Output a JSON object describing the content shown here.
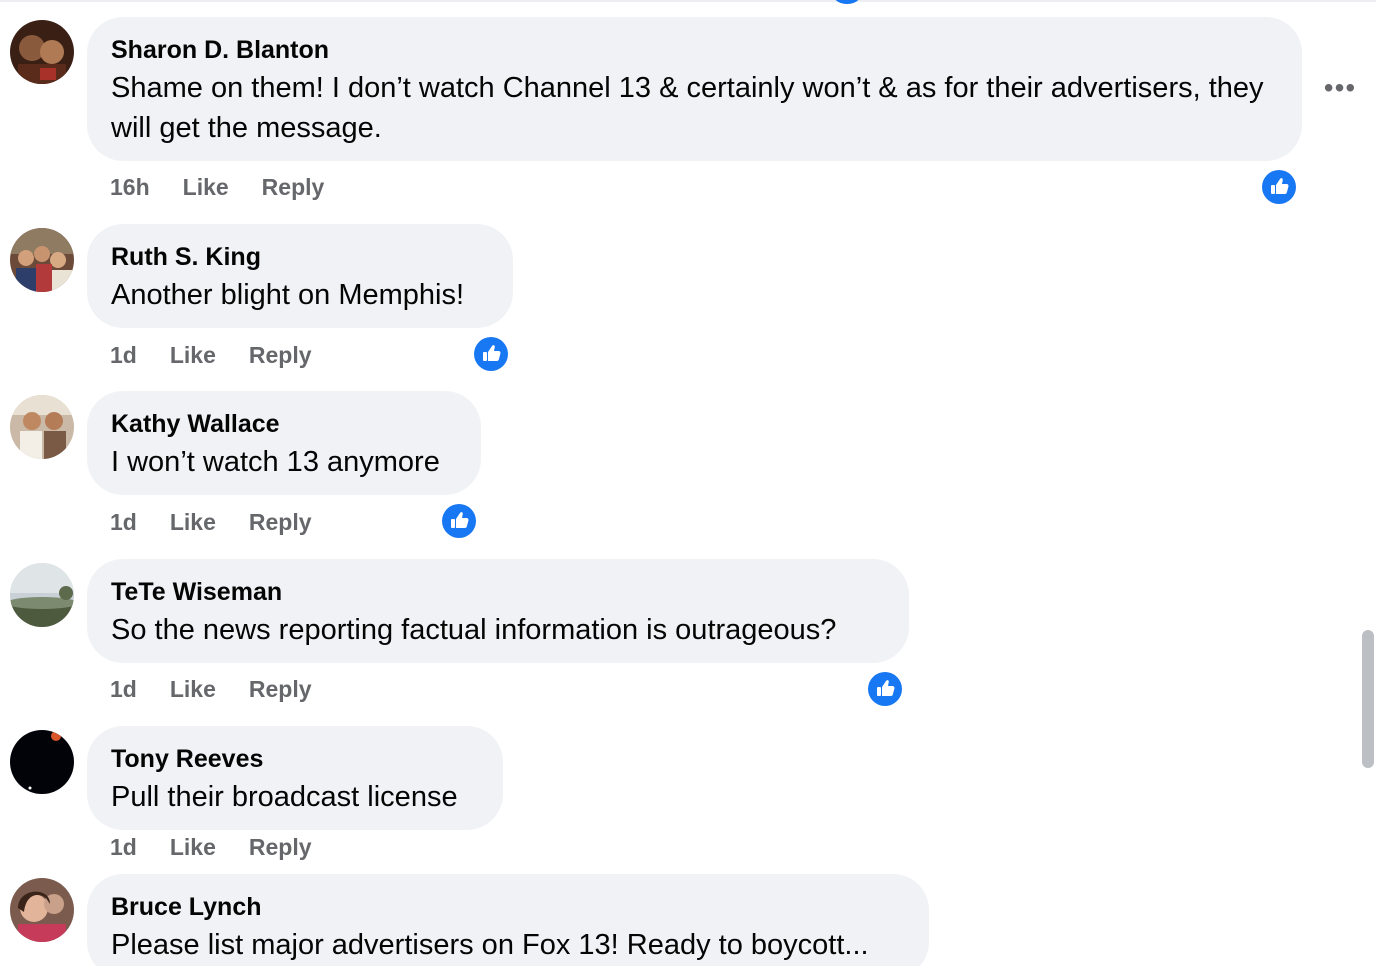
{
  "colors": {
    "bubble": "#f0f2f5",
    "meta_text": "#65676b",
    "like_blue": "#1877f2"
  },
  "more_icon": "•••",
  "comments": [
    {
      "author": "Sharon D. Blanton",
      "text": "Shame on them! I don’t watch Channel 13 & certainly won’t & as for their advertisers, they will get the message.",
      "time": "16h",
      "like": "Like",
      "reply": "Reply",
      "reaction": "like-icon"
    },
    {
      "author": "Ruth S. King",
      "text": "Another blight on Memphis!",
      "time": "1d",
      "like": "Like",
      "reply": "Reply",
      "reaction": "like-icon"
    },
    {
      "author": "Kathy Wallace",
      "text": "I won’t watch 13 anymore",
      "time": "1d",
      "like": "Like",
      "reply": "Reply",
      "reaction": "like-icon"
    },
    {
      "author": "TeTe Wiseman",
      "text": "So the news reporting factual information is outrageous?",
      "time": "1d",
      "like": "Like",
      "reply": "Reply",
      "reaction": "like-icon"
    },
    {
      "author": "Tony Reeves",
      "text": "Pull their broadcast license",
      "time": "1d",
      "like": "Like",
      "reply": "Reply"
    },
    {
      "author": "Bruce Lynch",
      "text": "Please list major advertisers on Fox 13! Ready to boycott..."
    }
  ]
}
